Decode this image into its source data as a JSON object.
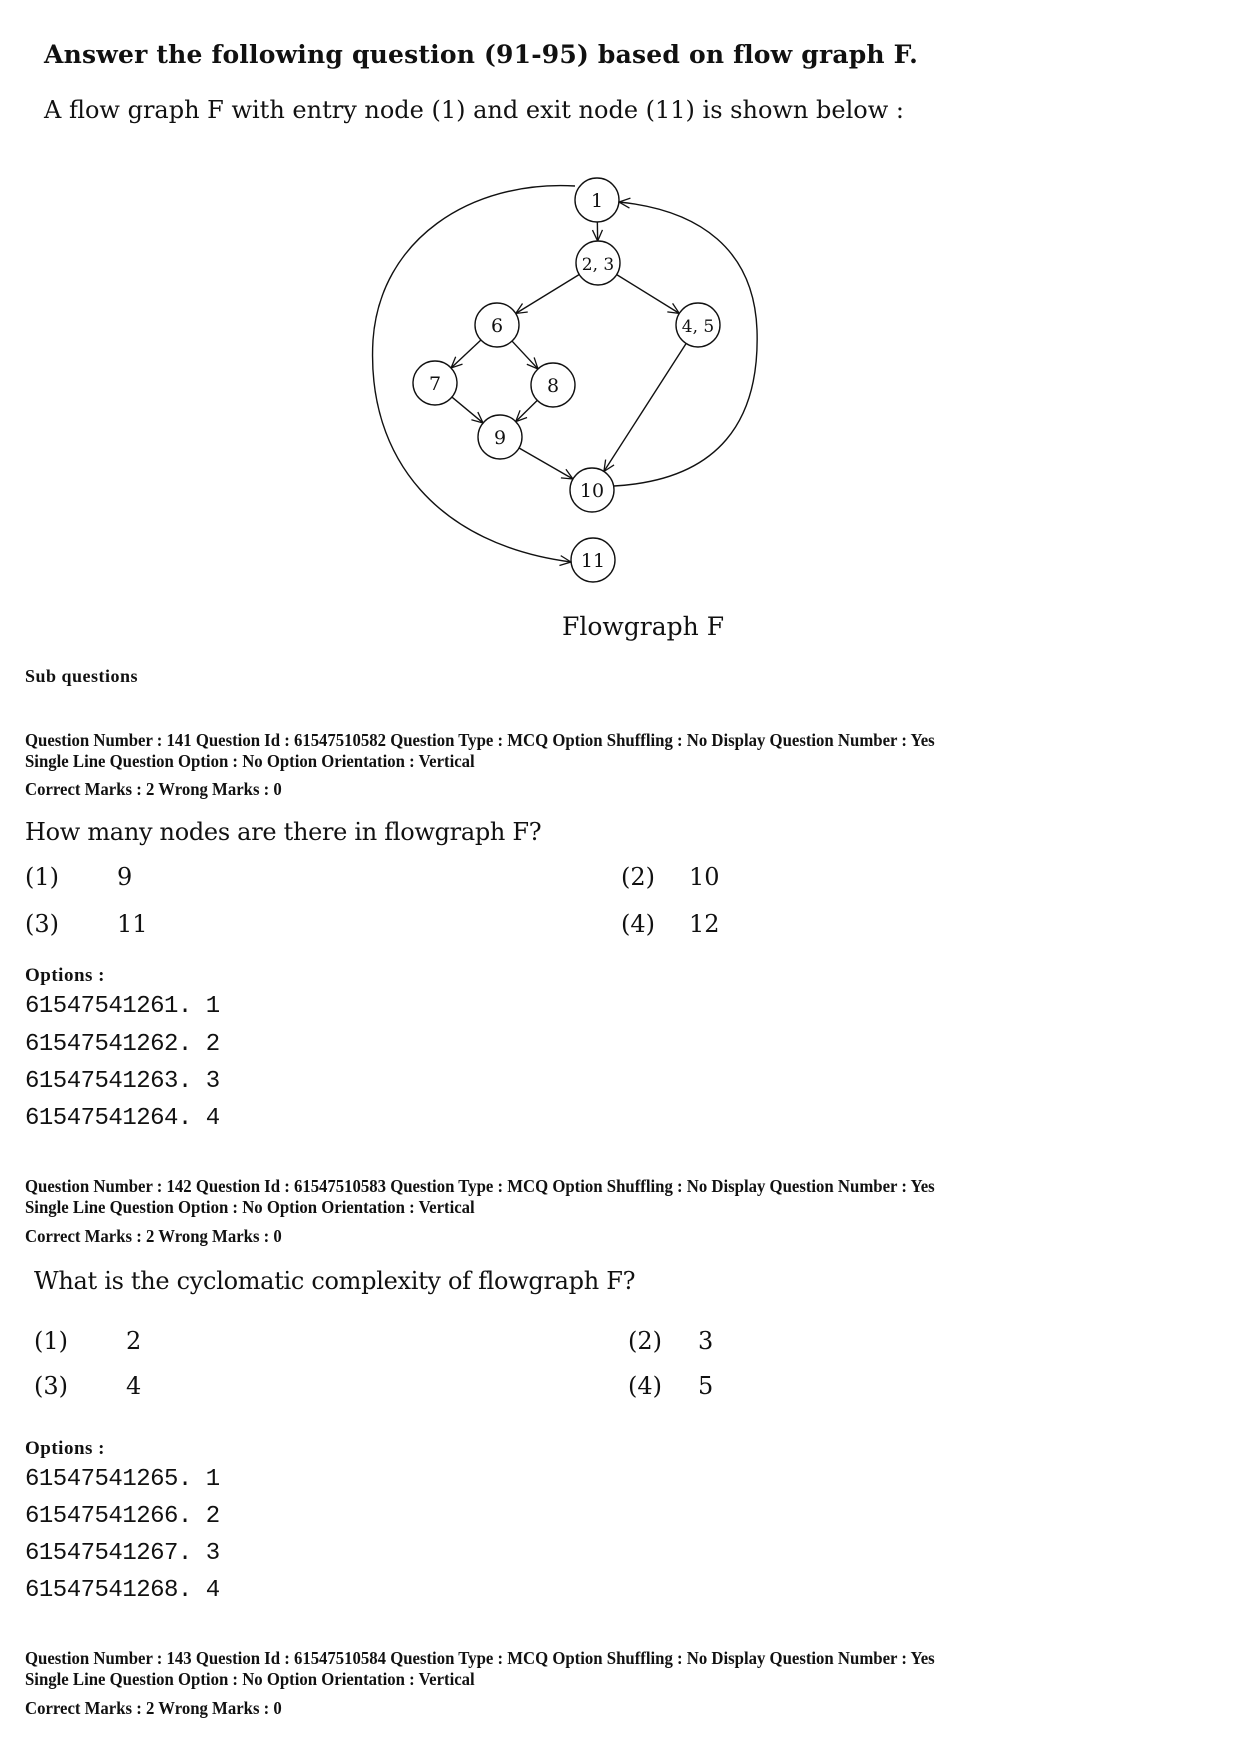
{
  "header": {
    "title": "Answer the following question (91-95) based on flow graph F.",
    "intro": "A flow graph F with entry node (1) and exit node (11) is shown below :"
  },
  "figure": {
    "caption": "Flowgraph F",
    "nodes": [
      {
        "id": "n1",
        "label": "1"
      },
      {
        "id": "n23",
        "label": "2, 3"
      },
      {
        "id": "n6",
        "label": "6"
      },
      {
        "id": "n45",
        "label": "4, 5"
      },
      {
        "id": "n7",
        "label": "7"
      },
      {
        "id": "n8",
        "label": "8"
      },
      {
        "id": "n9",
        "label": "9"
      },
      {
        "id": "n10",
        "label": "10"
      },
      {
        "id": "n11",
        "label": "11"
      }
    ],
    "edges": [
      {
        "from": "1",
        "to": "2, 3"
      },
      {
        "from": "2, 3",
        "to": "6"
      },
      {
        "from": "2, 3",
        "to": "4, 5"
      },
      {
        "from": "6",
        "to": "7"
      },
      {
        "from": "6",
        "to": "8"
      },
      {
        "from": "7",
        "to": "9"
      },
      {
        "from": "8",
        "to": "9"
      },
      {
        "from": "9",
        "to": "10"
      },
      {
        "from": "4, 5",
        "to": "10"
      },
      {
        "from": "10",
        "to": "1"
      },
      {
        "from": "1",
        "to": "11"
      }
    ]
  },
  "sub_questions_label": "Sub questions",
  "questions": [
    {
      "meta_line1": "Question Number : 141  Question Id : 61547510582  Question Type : MCQ  Option Shuffling : No  Display Question Number : Yes",
      "meta_line2": "Single Line Question Option : No  Option Orientation : Vertical",
      "marks": "Correct Marks : 2  Wrong Marks : 0",
      "text": "How many nodes are there in flowgraph F?",
      "choices": [
        {
          "num": "(1)",
          "value": "9"
        },
        {
          "num": "(2)",
          "value": "10"
        },
        {
          "num": "(3)",
          "value": "11"
        },
        {
          "num": "(4)",
          "value": "12"
        }
      ],
      "options_label": "Options :",
      "option_ids": [
        "61547541261. 1",
        "61547541262. 2",
        "61547541263. 3",
        "61547541264. 4"
      ]
    },
    {
      "meta_line1": "Question Number : 142  Question Id : 61547510583  Question Type : MCQ  Option Shuffling : No  Display Question Number : Yes",
      "meta_line2": "Single Line Question Option : No  Option Orientation : Vertical",
      "marks": "Correct Marks : 2  Wrong Marks : 0",
      "text": "What is the cyclomatic complexity of flowgraph F?",
      "choices": [
        {
          "num": "(1)",
          "value": "2"
        },
        {
          "num": "(2)",
          "value": "3"
        },
        {
          "num": "(3)",
          "value": "4"
        },
        {
          "num": "(4)",
          "value": "5"
        }
      ],
      "options_label": "Options :",
      "option_ids": [
        "61547541265. 1",
        "61547541266. 2",
        "61547541267. 3",
        "61547541268. 4"
      ]
    },
    {
      "meta_line1": "Question Number : 143  Question Id : 61547510584  Question Type : MCQ  Option Shuffling : No  Display Question Number : Yes",
      "meta_line2": "Single Line Question Option : No  Option Orientation : Vertical",
      "marks": "Correct Marks : 2  Wrong Marks : 0"
    }
  ]
}
